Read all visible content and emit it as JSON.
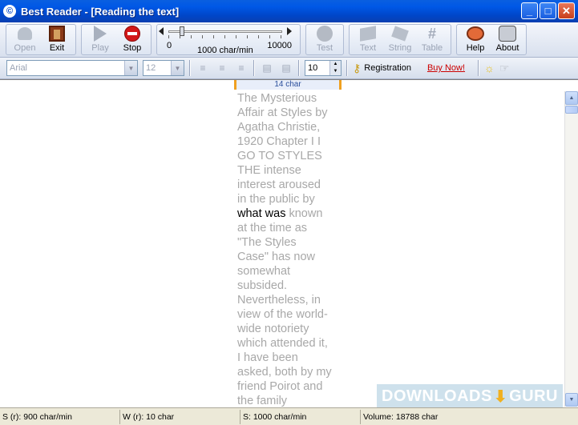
{
  "window": {
    "icon_glyph": "©",
    "title": "Best Reader - [Reading the text]",
    "controls": {
      "minimize": "_",
      "maximize": "□",
      "close": "✕"
    }
  },
  "toolbar": {
    "open": "Open",
    "exit": "Exit",
    "play": "Play",
    "stop": "Stop",
    "speed": {
      "min": "0",
      "current": "1000 char/min",
      "max": "10000",
      "thumb_fraction": 0.1
    },
    "test": "Test",
    "text": "Text",
    "string": "String",
    "table": "Table",
    "table_glyph": "#",
    "help": "Help",
    "about": "About"
  },
  "format_bar": {
    "font": "Arial",
    "size": "12",
    "line_width_value": "10",
    "registration": "Registration",
    "buy_now": "Buy Now!",
    "key_glyph": "⚷",
    "bulb_glyph": "☼",
    "hand_glyph": "☞"
  },
  "reader": {
    "ruler_label": "14 char",
    "lines": [
      {
        "pre": "The Mysterious",
        "hl": "",
        "post": ""
      },
      {
        "pre": "Affair at Styles  by",
        "hl": "",
        "post": ""
      },
      {
        "pre": "Agatha Christie,",
        "hl": "",
        "post": ""
      },
      {
        "pre": "1920   Chapter I   I",
        "hl": "",
        "post": ""
      },
      {
        "pre": "GO TO STYLES",
        "hl": "",
        "post": ""
      },
      {
        "pre": "THE intense",
        "hl": "",
        "post": ""
      },
      {
        "pre": "interest aroused",
        "hl": "",
        "post": ""
      },
      {
        "pre": "in the public by",
        "hl": "",
        "post": ""
      },
      {
        "pre": "",
        "hl": "what was",
        "post": " known"
      },
      {
        "pre": "at the time as",
        "hl": "",
        "post": ""
      },
      {
        "pre": "\"The Styles",
        "hl": "",
        "post": ""
      },
      {
        "pre": "Case\" has now",
        "hl": "",
        "post": ""
      },
      {
        "pre": "somewhat",
        "hl": "",
        "post": ""
      },
      {
        "pre": "subsided.",
        "hl": "",
        "post": ""
      },
      {
        "pre": "Nevertheless, in",
        "hl": "",
        "post": ""
      },
      {
        "pre": "view of the world-",
        "hl": "",
        "post": ""
      },
      {
        "pre": "wide notoriety",
        "hl": "",
        "post": ""
      },
      {
        "pre": "which attended it,",
        "hl": "",
        "post": ""
      },
      {
        "pre": "I have been",
        "hl": "",
        "post": ""
      },
      {
        "pre": "asked, both by my",
        "hl": "",
        "post": ""
      },
      {
        "pre": "friend Poirot and",
        "hl": "",
        "post": ""
      },
      {
        "pre": "the family",
        "hl": "",
        "post": ""
      }
    ],
    "watermark_left": "DOWNLOADS",
    "watermark_arrow": "⬇",
    "watermark_right": "GURU"
  },
  "status": {
    "s_r": "S (r): 900 char/min",
    "w_r": "W (r): 10 char",
    "s": "S: 1000 char/min",
    "volume": "Volume: 18788 char"
  }
}
